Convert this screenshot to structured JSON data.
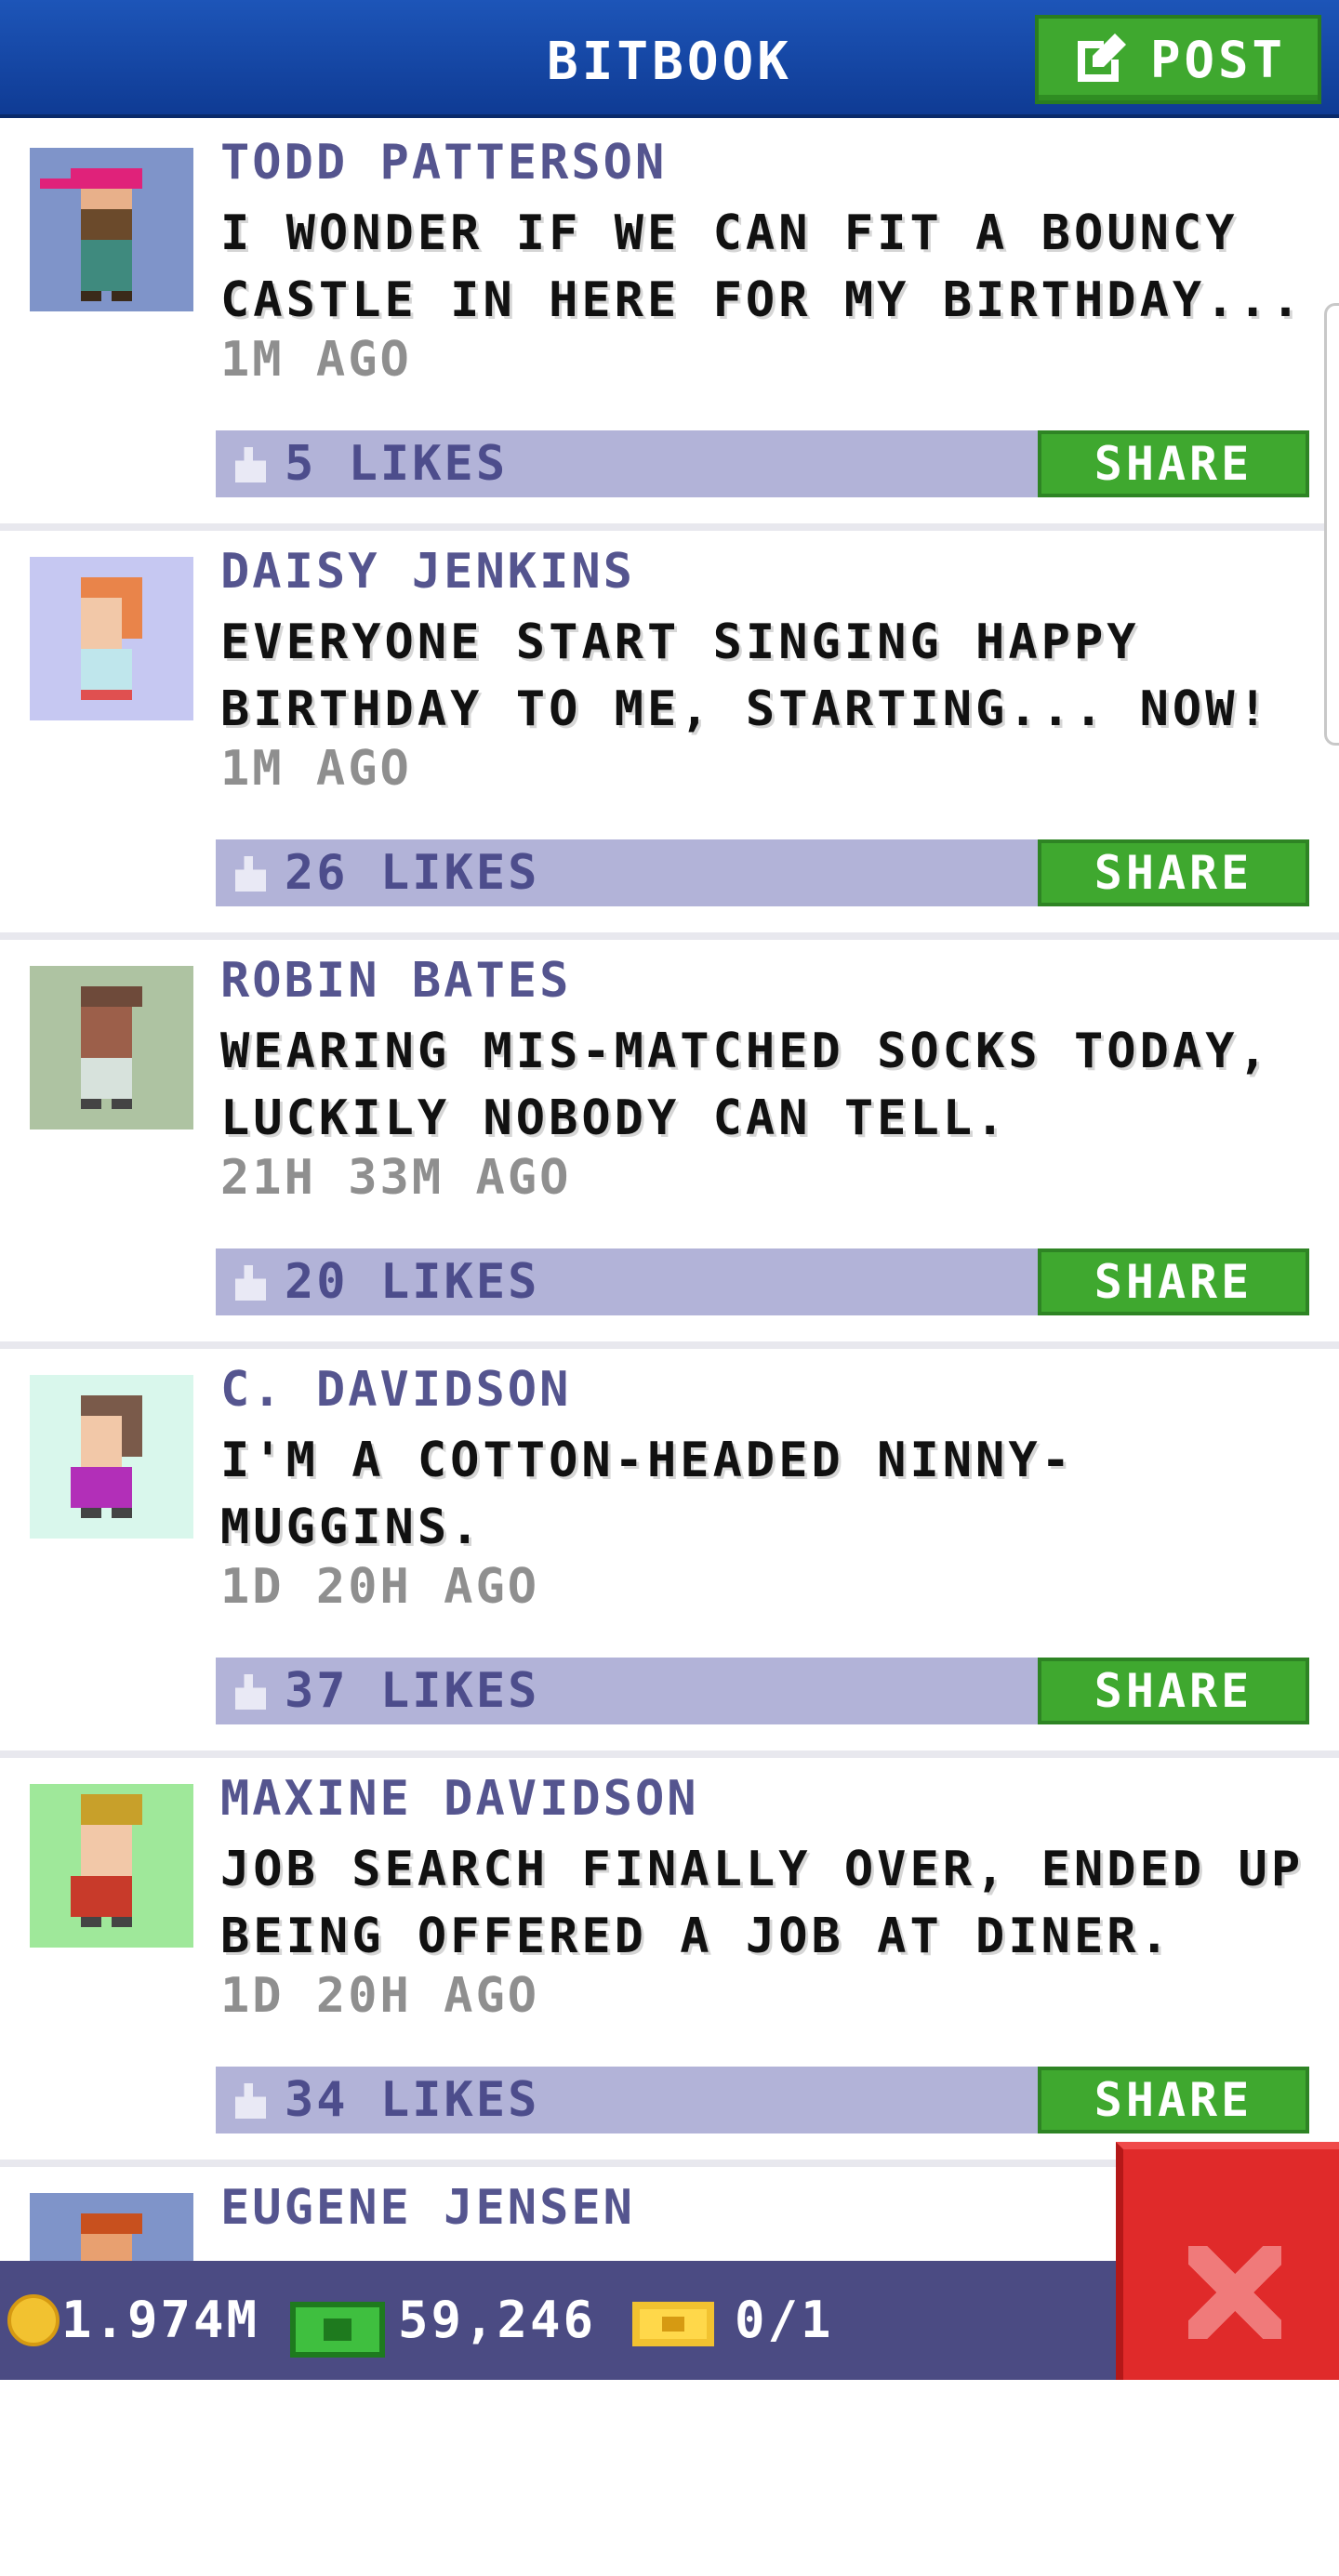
{
  "header": {
    "title": "BITBOOK",
    "post_label": "POST"
  },
  "posts": [
    {
      "author": "TODD PATTERSON",
      "message": "I WONDER IF WE CAN FIT A BOUNCY CASTLE IN HERE FOR MY BIRTHDAY...",
      "time": "1M AGO",
      "likes": "5 LIKES",
      "share": "SHARE",
      "avatar_bg": "#7f94c9"
    },
    {
      "author": "DAISY JENKINS",
      "message": "EVERYONE START SINGING HAPPY BIRTHDAY TO ME, STARTING... NOW!",
      "time": "1M AGO",
      "likes": "26 LIKES",
      "share": "SHARE",
      "avatar_bg": "#c6c8f2"
    },
    {
      "author": "ROBIN BATES",
      "message": "WEARING MIS-MATCHED SOCKS TODAY, LUCKILY NOBODY CAN TELL.",
      "time": "21H 33M AGO",
      "likes": "20 LIKES",
      "share": "SHARE",
      "avatar_bg": "#aec3a2"
    },
    {
      "author": "C. DAVIDSON",
      "message": "I'M A COTTON-HEADED NINNY-MUGGINS.",
      "time": "1D 20H AGO",
      "likes": "37 LIKES",
      "share": "SHARE",
      "avatar_bg": "#d9f7ec"
    },
    {
      "author": "MAXINE DAVIDSON",
      "message": "JOB SEARCH FINALLY OVER, ENDED UP BEING OFFERED A JOB AT DINER.",
      "time": "1D 20H AGO",
      "likes": "34 LIKES",
      "share": "SHARE",
      "avatar_bg": "#9fe89a"
    },
    {
      "author": "EUGENE JENSEN",
      "message": "",
      "time": "",
      "likes": "",
      "share": "",
      "avatar_bg": "#7f94c9"
    }
  ],
  "status_bar": {
    "coins": "1.974M",
    "bux": "59,246",
    "tickets": "0/1"
  },
  "icons": {
    "post": "edit-icon",
    "like": "thumbs-up-icon",
    "coin": "coin-icon",
    "bux": "cash-icon",
    "ticket": "ticket-icon",
    "close": "close-icon"
  },
  "colors": {
    "header": "#1d55b8",
    "accent_green": "#3fa82f",
    "likes_bar": "#b2b3d8",
    "author_text": "#55558f",
    "close_red": "#e02a2a"
  }
}
